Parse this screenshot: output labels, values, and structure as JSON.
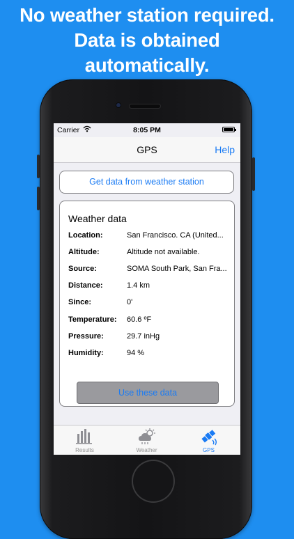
{
  "headline": {
    "line1": "No weather station required.",
    "line2": "Data is obtained",
    "line3": "automatically."
  },
  "status_bar": {
    "carrier": "Carrier",
    "time": "8:05 PM"
  },
  "nav": {
    "title": "GPS",
    "help": "Help"
  },
  "station_button": "Get data from weather station",
  "weather": {
    "title": "Weather data",
    "rows": [
      {
        "label": "Location:",
        "value": "San Francisco. CA (United..."
      },
      {
        "label": "Altitude:",
        "value": "Altitude not available."
      },
      {
        "label": "Source:",
        "value": "SOMA South Park, San Fra..."
      },
      {
        "label": "Distance:",
        "value": "1.4 km"
      },
      {
        "label": "Since:",
        "value": "0'"
      },
      {
        "label": "Temperature:",
        "value": "60.6 ºF"
      },
      {
        "label": "Pressure:",
        "value": "29.7 inHg"
      },
      {
        "label": "Humidity:",
        "value": "94 %"
      }
    ],
    "use_button": "Use these data"
  },
  "tabs": [
    {
      "label": "Results",
      "icon": "bar-chart-icon",
      "active": false
    },
    {
      "label": "Weather",
      "icon": "weather-cloud-icon",
      "active": false
    },
    {
      "label": "GPS",
      "icon": "satellite-icon",
      "active": true
    }
  ],
  "colors": {
    "background": "#1e8ef0",
    "accent": "#1a7bf4",
    "inactive_tab": "#929292"
  }
}
